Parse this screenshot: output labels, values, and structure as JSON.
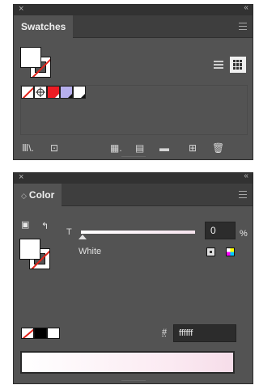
{
  "swatches_panel": {
    "close_glyph": "×",
    "collapse_glyph": "‹‹",
    "tab_label": "Swatches",
    "menu_icon": "hamburger-menu-icon",
    "view_list_icon": "list-view-icon",
    "view_grid_icon": "grid-view-icon",
    "active_view": "grid",
    "swatch_items": [
      {
        "name": "none-swatch",
        "color": "#ffffff"
      },
      {
        "name": "registration-swatch",
        "color": "#ffffff"
      },
      {
        "name": "red-swatch",
        "color": "#ed1c24"
      },
      {
        "name": "lilac-swatch",
        "color": "#b7b0ee"
      },
      {
        "name": "white-swatch",
        "color": "#ffffff"
      }
    ],
    "footer_icons": {
      "libraries": "Ⅲ\\.",
      "show_kinds": "⊡",
      "swatch_options": "▦.",
      "color_group": "▤",
      "new_group": "▬",
      "new_swatch": "⊞",
      "delete": "🗑"
    }
  },
  "color_panel": {
    "close_glyph": "×",
    "collapse_glyph": "‹‹",
    "tab_label": "Color",
    "tab_arrow": "◇",
    "menu_icon": "hamburger-menu-icon",
    "swap_icon": "↰",
    "default_icon": "▣",
    "tint_label": "T",
    "tint_value": "0",
    "percent_sign": "%",
    "color_name": "White",
    "hex_label": "#",
    "hex_value": "ffffff",
    "spectrum_colors": [
      "#ffffff",
      "#f6dde9"
    ]
  }
}
